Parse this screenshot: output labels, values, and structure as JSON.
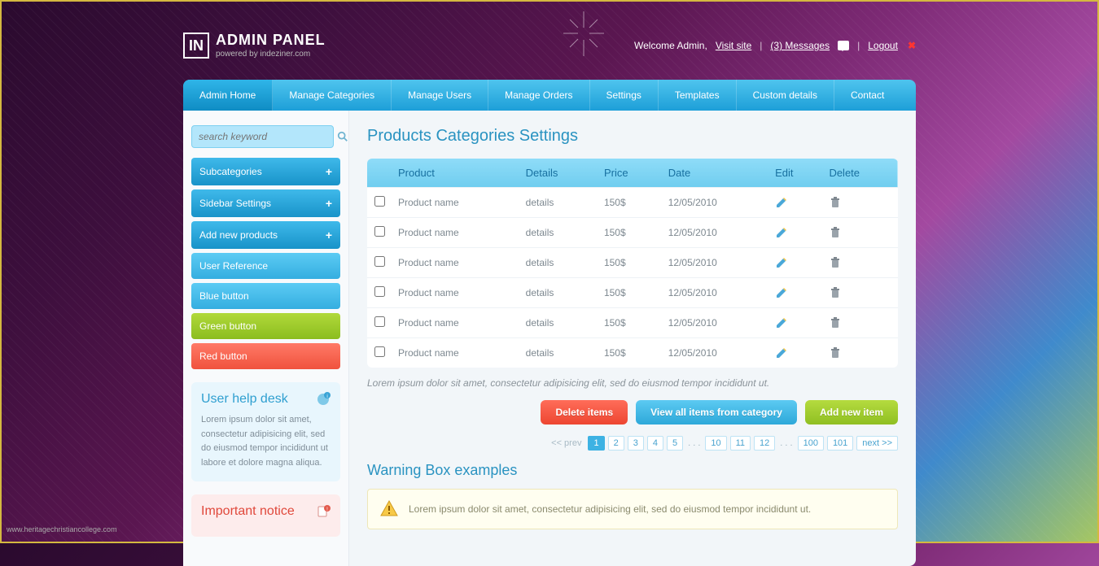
{
  "header": {
    "logo_mark": "IN",
    "logo_title": "ADMIN PANEL",
    "logo_sub": "powered by indeziner.com",
    "welcome": "Welcome Admin,",
    "visit_site": "Visit site",
    "messages": "(3) Messages",
    "logout": "Logout"
  },
  "nav": [
    "Admin Home",
    "Manage Categories",
    "Manage Users",
    "Manage Orders",
    "Settings",
    "Templates",
    "Custom details",
    "Contact"
  ],
  "sidebar": {
    "search_placeholder": "search keyword",
    "buttons": [
      {
        "label": "Subcategories",
        "style": "grad-blue-dark",
        "plus": true
      },
      {
        "label": "Sidebar Settings",
        "style": "grad-blue-dark",
        "plus": true
      },
      {
        "label": "Add new products",
        "style": "grad-blue-dark",
        "plus": true
      },
      {
        "label": "User Reference",
        "style": "grad-blue",
        "plus": false
      },
      {
        "label": "Blue button",
        "style": "grad-blue",
        "plus": false
      },
      {
        "label": "Green button",
        "style": "grad-green",
        "plus": false
      },
      {
        "label": "Red button",
        "style": "grad-red",
        "plus": false
      }
    ],
    "help": {
      "title": "User help desk",
      "text": "Lorem ipsum dolor sit amet, consectetur adipisicing elit, sed do eiusmod tempor incididunt ut labore et dolore magna aliqua."
    },
    "notice": {
      "title": "Important notice"
    }
  },
  "main": {
    "page_title": "Products Categories Settings",
    "columns": [
      "",
      "Product",
      "Details",
      "Price",
      "Date",
      "Edit",
      "Delete"
    ],
    "rows": [
      {
        "product": "Product name",
        "details": "details",
        "price": "150$",
        "date": "12/05/2010"
      },
      {
        "product": "Product name",
        "details": "details",
        "price": "150$",
        "date": "12/05/2010"
      },
      {
        "product": "Product name",
        "details": "details",
        "price": "150$",
        "date": "12/05/2010"
      },
      {
        "product": "Product name",
        "details": "details",
        "price": "150$",
        "date": "12/05/2010"
      },
      {
        "product": "Product name",
        "details": "details",
        "price": "150$",
        "date": "12/05/2010"
      },
      {
        "product": "Product name",
        "details": "details",
        "price": "150$",
        "date": "12/05/2010"
      }
    ],
    "caption": "Lorem ipsum dolor sit amet, consectetur adipisicing elit, sed do eiusmod tempor incididunt ut.",
    "actions": {
      "delete": "Delete items",
      "view_all": "View all items from category",
      "add_new": "Add new item"
    },
    "pagination": {
      "prev": "<< prev",
      "pages_a": [
        "1",
        "2",
        "3",
        "4",
        "5"
      ],
      "pages_b": [
        "10",
        "11",
        "12"
      ],
      "pages_c": [
        "100",
        "101"
      ],
      "next": "next >>"
    },
    "warning_title": "Warning Box examples",
    "warning_text": "Lorem ipsum dolor sit amet, consectetur adipisicing elit, sed do eiusmod tempor incididunt ut."
  },
  "watermark": "www.heritagechristiancollege.com"
}
